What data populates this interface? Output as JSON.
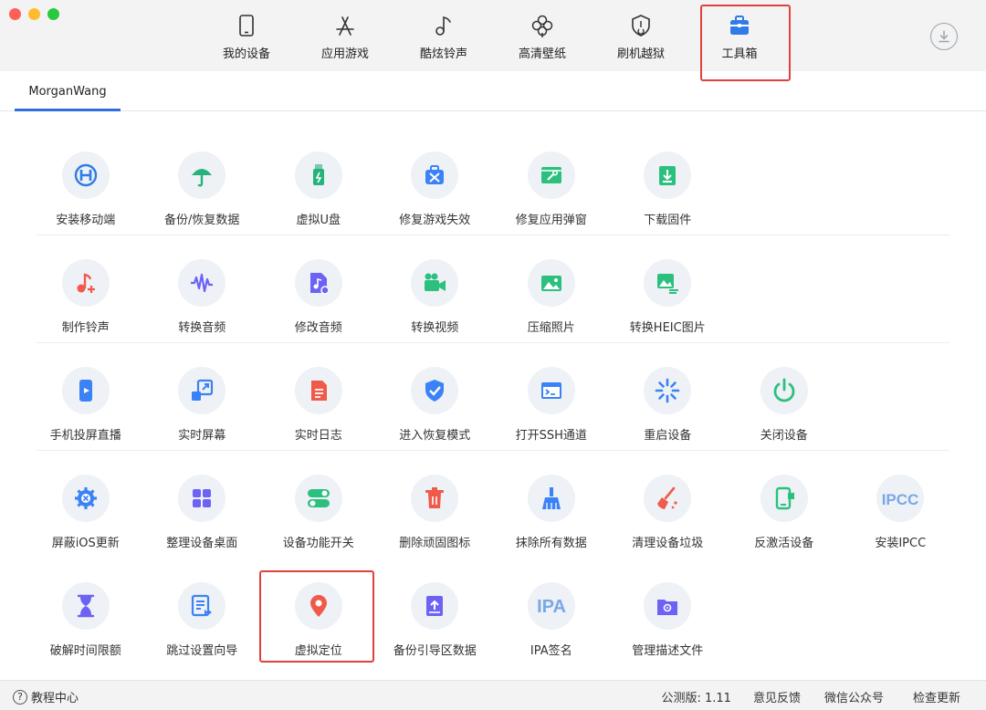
{
  "nav": {
    "items": [
      {
        "label": "我的设备",
        "icon": "phone-icon"
      },
      {
        "label": "应用游戏",
        "icon": "app-store-icon"
      },
      {
        "label": "酷炫铃声",
        "icon": "music-note-icon"
      },
      {
        "label": "高清壁纸",
        "icon": "flower-icon"
      },
      {
        "label": "刷机越狱",
        "icon": "shield-icon"
      },
      {
        "label": "工具箱",
        "icon": "toolbox-icon"
      }
    ],
    "active": "工具箱"
  },
  "device_tab": "MorganWang",
  "rows": [
    [
      {
        "label": "安装移动端",
        "icon": "install-mobile-icon",
        "color": "#2f7be8"
      },
      {
        "label": "备份/恢复数据",
        "icon": "umbrella-icon",
        "color": "#26b27c"
      },
      {
        "label": "虚拟U盘",
        "icon": "usb-drive-icon",
        "color": "#26b27c"
      },
      {
        "label": "修复游戏失效",
        "icon": "toolbox-repair-icon",
        "color": "#3b82f6"
      },
      {
        "label": "修复应用弹窗",
        "icon": "window-repair-icon",
        "color": "#2cc07f"
      },
      {
        "label": "下载固件",
        "icon": "download-firmware-icon",
        "color": "#2cc07f"
      }
    ],
    [
      {
        "label": "制作铃声",
        "icon": "make-ringtone-icon",
        "color": "#f05a4a"
      },
      {
        "label": "转换音频",
        "icon": "waveform-icon",
        "color": "#6c63f5"
      },
      {
        "label": "修改音频",
        "icon": "audio-file-icon",
        "color": "#6c63f5"
      },
      {
        "label": "转换视频",
        "icon": "video-camera-icon",
        "color": "#2cc07f"
      },
      {
        "label": "压缩照片",
        "icon": "photo-icon",
        "color": "#2cc07f"
      },
      {
        "label": "转换HEIC图片",
        "icon": "heic-image-icon",
        "color": "#2cc07f"
      }
    ],
    [
      {
        "label": "手机投屏直播",
        "icon": "screen-cast-icon",
        "color": "#3b82f6"
      },
      {
        "label": "实时屏幕",
        "icon": "live-screen-icon",
        "color": "#3b82f6"
      },
      {
        "label": "实时日志",
        "icon": "log-file-icon",
        "color": "#f05a4a"
      },
      {
        "label": "进入恢复模式",
        "icon": "shield-check-icon",
        "color": "#3b82f6"
      },
      {
        "label": "打开SSH通道",
        "icon": "terminal-window-icon",
        "color": "#3b82f6"
      },
      {
        "label": "重启设备",
        "icon": "restart-spinner-icon",
        "color": "#3b82f6"
      },
      {
        "label": "关闭设备",
        "icon": "power-icon",
        "color": "#2cc07f"
      }
    ],
    [
      {
        "label": "屏蔽iOS更新",
        "icon": "gear-block-icon",
        "color": "#3b82f6"
      },
      {
        "label": "整理设备桌面",
        "icon": "grid-icon",
        "color": "#6c63f5"
      },
      {
        "label": "设备功能开关",
        "icon": "toggle-icon",
        "color": "#2cc07f"
      },
      {
        "label": "删除顽固图标",
        "icon": "trash-icon",
        "color": "#f05a4a"
      },
      {
        "label": "抹除所有数据",
        "icon": "broom-icon",
        "color": "#3b82f6"
      },
      {
        "label": "清理设备垃圾",
        "icon": "clean-brush-icon",
        "color": "#f05a4a"
      },
      {
        "label": "反激活设备",
        "icon": "deactivate-phone-icon",
        "color": "#2cc07f"
      },
      {
        "label": "安装IPCC",
        "icon": "ipcc-icon",
        "color": "#7aa7e8",
        "text": "IPCC"
      }
    ],
    [
      {
        "label": "破解时间限额",
        "icon": "hourglass-icon",
        "color": "#6c63f5"
      },
      {
        "label": "跳过设置向导",
        "icon": "skip-setup-icon",
        "color": "#3b82f6"
      },
      {
        "label": "虚拟定位",
        "icon": "location-pin-icon",
        "color": "#f05a4a"
      },
      {
        "label": "备份引导区数据",
        "icon": "backup-boot-icon",
        "color": "#6c63f5"
      },
      {
        "label": "IPA签名",
        "icon": "ipa-icon",
        "color": "#7aa7e8",
        "text": "IPA"
      },
      {
        "label": "管理描述文件",
        "icon": "profile-folder-icon",
        "color": "#6c63f5"
      }
    ]
  ],
  "footer": {
    "help": "教程中心",
    "help_icon": "?",
    "version": "公测版: 1.11",
    "feedback": "意见反馈",
    "wechat": "微信公众号",
    "update": "检查更新"
  }
}
